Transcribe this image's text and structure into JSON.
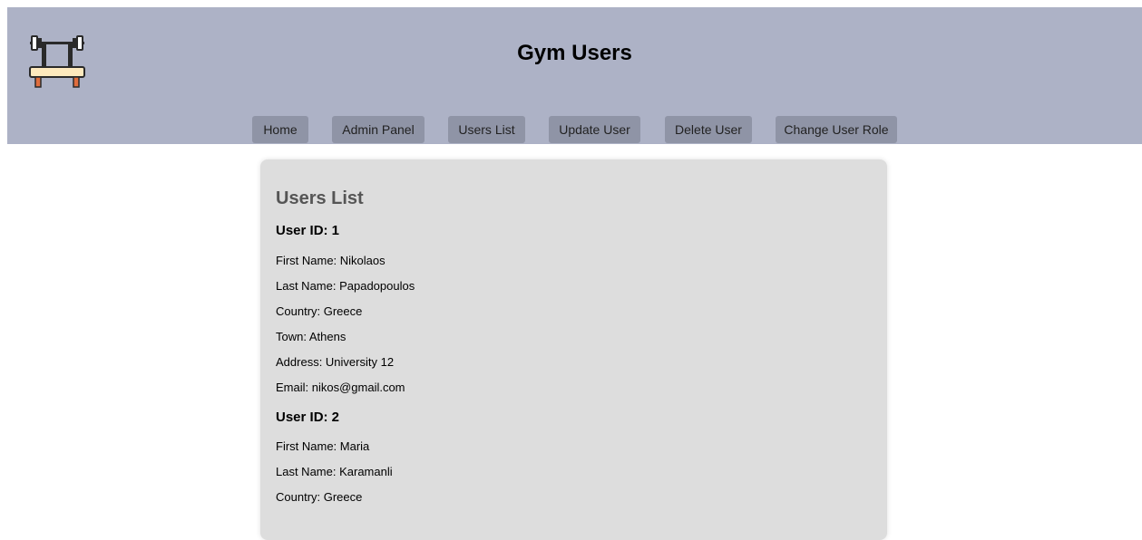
{
  "header": {
    "title": "Gym Users"
  },
  "nav": {
    "home": "Home",
    "admin_panel": "Admin Panel",
    "users_list": "Users List",
    "update_user": "Update User",
    "delete_user": "Delete User",
    "change_user_role": "Change User Role"
  },
  "main": {
    "title": "Users List",
    "users": [
      {
        "id_label": "User ID: 1",
        "first_name": "First Name: Nikolaos",
        "last_name": "Last Name: Papadopoulos",
        "country": "Country: Greece",
        "town": "Town: Athens",
        "address": "Address: University 12",
        "email": "Email: nikos@gmail.com"
      },
      {
        "id_label": "User ID: 2",
        "first_name": "First Name: Maria",
        "last_name": "Last Name: Karamanli",
        "country": "Country: Greece"
      }
    ]
  },
  "icons": {
    "logo": "weight-bench-barbell-icon"
  },
  "colors": {
    "header_bg": "#adb2c6",
    "nav_button_bg": "#8f94a6",
    "panel_bg": "#dddddd",
    "panel_title": "#555555"
  }
}
